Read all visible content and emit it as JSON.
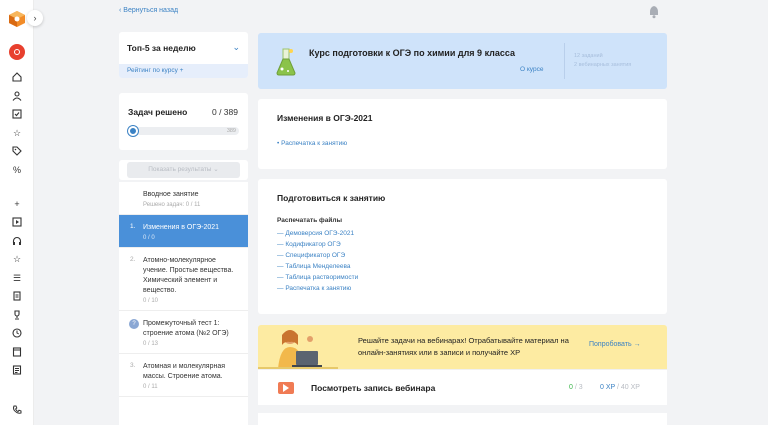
{
  "nav": {
    "back_label": "‹ Вернуться назад"
  },
  "top5": {
    "title": "Топ-5 за неделю",
    "rating_label": "Рейтинг по курсу +"
  },
  "solved": {
    "label": "Задач решено",
    "count": "0 / 389",
    "progress_max": "389",
    "progress_fraction": 0
  },
  "show_results": {
    "label": "Показать результаты"
  },
  "lessons": [
    {
      "num": "",
      "title": "Вводное занятие",
      "meta": "Решено задач: 0 / 11"
    },
    {
      "num": "1.",
      "title": "Изменения в ОГЭ-2021",
      "meta": "0 / 0"
    },
    {
      "num": "2.",
      "title": "Атомно-молекулярное учение. Простые вещества. Химический элемент и вещество.",
      "meta": "0 / 10"
    },
    {
      "num": "",
      "title": "Промежуточный тест 1: строение атома (№2 ОГЭ)",
      "meta": "0 / 13"
    },
    {
      "num": "3.",
      "title": "Атомная и молекулярная массы. Строение атома.",
      "meta": "0 / 11"
    }
  ],
  "course": {
    "title": "Курс подготовки к ОГЭ по химии для 9 класса",
    "about_label": "О курсе",
    "stats": [
      "12 заданий",
      "2 вебинарных занятия"
    ]
  },
  "changes_card": {
    "title": "Изменения в ОГЭ-2021",
    "link": "Распечатка к занятию"
  },
  "prepare_card": {
    "title": "Подготовиться к занятию",
    "files_heading": "Распечатать файлы",
    "files": [
      "Демоверсия ОГЭ-2021",
      "Кодификатор ОГЭ",
      "Спецификатор ОГЭ",
      "Таблица Менделеева",
      "Таблица растворимости",
      "Распечатка к занятию"
    ]
  },
  "webinar": {
    "text": "Решайте задачи на вебинарах! Отрабатывайте материал на онлайн-занятиях или в записи и получайте XP",
    "try_label": "Попробовать"
  },
  "watch": {
    "title": "Посмотреть запись вебинара",
    "score_done": "0",
    "score_total": " / 3",
    "xp_done": "0 XP",
    "xp_total": " / 40 XP"
  },
  "colors": {
    "accent": "#4a90d9",
    "link": "#3b82c4",
    "banner": "#cfe3fa",
    "webinar_bg": "#fdeba2",
    "record": "#e8402e"
  }
}
